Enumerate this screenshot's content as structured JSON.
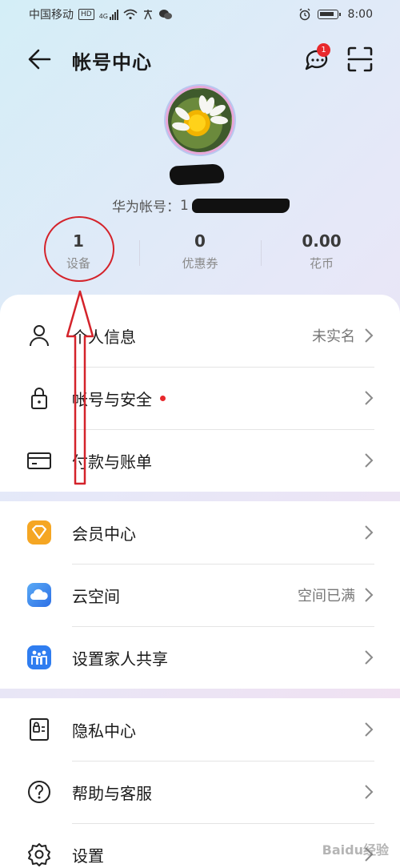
{
  "status_bar": {
    "carrier": "中国移动",
    "hd": "HD",
    "signal": "4G",
    "time": "8:00"
  },
  "header": {
    "title": "帐号中心",
    "message_badge": "1"
  },
  "profile": {
    "account_label": "华为帐号：",
    "account_visible": "1"
  },
  "stats": [
    {
      "value": "1",
      "label": "设备"
    },
    {
      "value": "0",
      "label": "优惠券"
    },
    {
      "value": "0.00",
      "label": "花币"
    }
  ],
  "section1": [
    {
      "label": "个人信息",
      "value": "未实名",
      "icon": "person-icon"
    },
    {
      "label": "帐号与安全",
      "value": "",
      "icon": "lock-icon"
    },
    {
      "label": "付款与账单",
      "value": "",
      "icon": "card-icon"
    }
  ],
  "section2": [
    {
      "label": "会员中心",
      "value": "",
      "icon": "vip-icon",
      "color": "#f5a623"
    },
    {
      "label": "云空间",
      "value": "空间已满",
      "icon": "cloud-icon",
      "color": "#3b82f6"
    },
    {
      "label": "设置家人共享",
      "value": "",
      "icon": "family-icon",
      "color": "#2f7df0"
    }
  ],
  "section3": [
    {
      "label": "隐私中心",
      "value": "",
      "icon": "privacy-icon"
    },
    {
      "label": "帮助与客服",
      "value": "",
      "icon": "help-icon"
    },
    {
      "label": "设置",
      "value": "",
      "icon": "gear-icon"
    }
  ],
  "watermark": "Baidu经验",
  "colors": {
    "accent_red": "#e8282c",
    "annotation_red": "#d4232b"
  }
}
